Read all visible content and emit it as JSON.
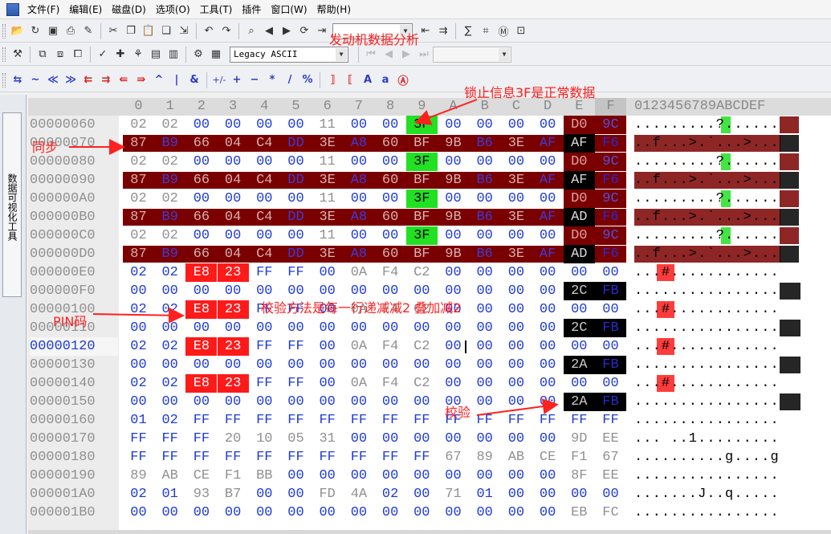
{
  "menu": [
    "文件(F)",
    "编辑(E)",
    "磁盘(D)",
    "选项(O)",
    "工具(T)",
    "插件",
    "窗口(W)",
    "帮助(H)"
  ],
  "toolbar": {
    "encoding": "Legacy ASCII"
  },
  "sidebar": {
    "tab": "数据可视化工具"
  },
  "hex": {
    "columns": [
      "0",
      "1",
      "2",
      "3",
      "4",
      "5",
      "6",
      "7",
      "8",
      "9",
      "A",
      "B",
      "C",
      "D",
      "E",
      "F"
    ],
    "ascii_header": "0123456789ABCDEF",
    "current_offset": "00000120",
    "rows": [
      {
        "offset": "00000060",
        "bytes": [
          "02",
          "02",
          "00",
          "00",
          "00",
          "00",
          "11",
          "00",
          "00",
          "3F",
          "00",
          "00",
          "00",
          "00",
          "D0",
          "9C"
        ],
        "ascii": ".........?......"
      },
      {
        "offset": "00000070",
        "bytes": [
          "87",
          "B9",
          "66",
          "04",
          "C4",
          "DD",
          "3E",
          "A8",
          "60",
          "BF",
          "9B",
          "B6",
          "3E",
          "AF",
          "AF",
          "F6"
        ],
        "ascii": "..f...>.`...>..."
      },
      {
        "offset": "00000080",
        "bytes": [
          "02",
          "02",
          "00",
          "00",
          "00",
          "00",
          "11",
          "00",
          "00",
          "3F",
          "00",
          "00",
          "00",
          "00",
          "D0",
          "9C"
        ],
        "ascii": ".........?......"
      },
      {
        "offset": "00000090",
        "bytes": [
          "87",
          "B9",
          "66",
          "04",
          "C4",
          "DD",
          "3E",
          "A8",
          "60",
          "BF",
          "9B",
          "B6",
          "3E",
          "AF",
          "AF",
          "F6"
        ],
        "ascii": "..f...>.`...>..."
      },
      {
        "offset": "000000A0",
        "bytes": [
          "02",
          "02",
          "00",
          "00",
          "00",
          "00",
          "11",
          "00",
          "00",
          "3F",
          "00",
          "00",
          "00",
          "00",
          "D0",
          "9C"
        ],
        "ascii": ".........?......"
      },
      {
        "offset": "000000B0",
        "bytes": [
          "87",
          "B9",
          "66",
          "04",
          "C4",
          "DD",
          "3E",
          "A8",
          "60",
          "BF",
          "9B",
          "B6",
          "3E",
          "AF",
          "AD",
          "F6"
        ],
        "ascii": "..f...>.`...>..."
      },
      {
        "offset": "000000C0",
        "bytes": [
          "02",
          "02",
          "00",
          "00",
          "00",
          "00",
          "11",
          "00",
          "00",
          "3F",
          "00",
          "00",
          "00",
          "00",
          "D0",
          "9C"
        ],
        "ascii": ".........?......"
      },
      {
        "offset": "000000D0",
        "bytes": [
          "87",
          "B9",
          "66",
          "04",
          "C4",
          "DD",
          "3E",
          "A8",
          "60",
          "BF",
          "9B",
          "B6",
          "3E",
          "AF",
          "AD",
          "F6"
        ],
        "ascii": "..f...>.`...>..."
      },
      {
        "offset": "000000E0",
        "bytes": [
          "02",
          "02",
          "E8",
          "23",
          "FF",
          "FF",
          "00",
          "0A",
          "F4",
          "C2",
          "00",
          "00",
          "00",
          "00",
          "00",
          "00"
        ],
        "ascii": "...#............"
      },
      {
        "offset": "000000F0",
        "bytes": [
          "00",
          "00",
          "00",
          "00",
          "00",
          "00",
          "00",
          "00",
          "00",
          "00",
          "00",
          "00",
          "00",
          "00",
          "2C",
          "FB"
        ],
        "ascii": "................"
      },
      {
        "offset": "00000100",
        "bytes": [
          "02",
          "02",
          "E8",
          "23",
          "FF",
          "FF",
          "00",
          "0A",
          "F4",
          "C2",
          "00",
          "00",
          "00",
          "00",
          "00",
          "00"
        ],
        "ascii": "...#............"
      },
      {
        "offset": "00000110",
        "bytes": [
          "00",
          "00",
          "00",
          "00",
          "00",
          "00",
          "00",
          "00",
          "00",
          "00",
          "00",
          "00",
          "00",
          "00",
          "2C",
          "FB"
        ],
        "ascii": "................"
      },
      {
        "offset": "00000120",
        "bytes": [
          "02",
          "02",
          "E8",
          "23",
          "FF",
          "FF",
          "00",
          "0A",
          "F4",
          "C2",
          "00",
          "00",
          "00",
          "00",
          "00",
          "00"
        ],
        "ascii": "...#............"
      },
      {
        "offset": "00000130",
        "bytes": [
          "00",
          "00",
          "00",
          "00",
          "00",
          "00",
          "00",
          "00",
          "00",
          "00",
          "00",
          "00",
          "00",
          "00",
          "2A",
          "FB"
        ],
        "ascii": "................"
      },
      {
        "offset": "00000140",
        "bytes": [
          "02",
          "02",
          "E8",
          "23",
          "FF",
          "FF",
          "00",
          "0A",
          "F4",
          "C2",
          "00",
          "00",
          "00",
          "00",
          "00",
          "00"
        ],
        "ascii": "...#............"
      },
      {
        "offset": "00000150",
        "bytes": [
          "00",
          "00",
          "00",
          "00",
          "00",
          "00",
          "00",
          "00",
          "00",
          "00",
          "00",
          "00",
          "00",
          "00",
          "2A",
          "FB"
        ],
        "ascii": "................"
      },
      {
        "offset": "00000160",
        "bytes": [
          "01",
          "02",
          "FF",
          "FF",
          "FF",
          "FF",
          "FF",
          "FF",
          "FF",
          "FF",
          "FF",
          "FF",
          "FF",
          "FF",
          "FF",
          "FF"
        ],
        "ascii": "................"
      },
      {
        "offset": "00000170",
        "bytes": [
          "FF",
          "FF",
          "FF",
          "20",
          "10",
          "05",
          "31",
          "00",
          "00",
          "00",
          "00",
          "00",
          "00",
          "00",
          "9D",
          "EE"
        ],
        "ascii": "... ..1........."
      },
      {
        "offset": "00000180",
        "bytes": [
          "FF",
          "FF",
          "FF",
          "FF",
          "FF",
          "FF",
          "FF",
          "FF",
          "FF",
          "FF",
          "67",
          "89",
          "AB",
          "CE",
          "F1",
          "67"
        ],
        "ascii": "..........g....g"
      },
      {
        "offset": "00000190",
        "bytes": [
          "89",
          "AB",
          "CE",
          "F1",
          "BB",
          "00",
          "00",
          "00",
          "00",
          "00",
          "00",
          "00",
          "00",
          "00",
          "8F",
          "EE"
        ],
        "ascii": "................"
      },
      {
        "offset": "000001A0",
        "bytes": [
          "02",
          "01",
          "93",
          "B7",
          "00",
          "00",
          "FD",
          "4A",
          "02",
          "00",
          "71",
          "01",
          "00",
          "00",
          "00",
          "00"
        ],
        "ascii": ".......J..q....."
      },
      {
        "offset": "000001B0",
        "bytes": [
          "00",
          "00",
          "00",
          "00",
          "00",
          "00",
          "00",
          "00",
          "00",
          "00",
          "00",
          "00",
          "00",
          "00",
          "EB",
          "FC"
        ],
        "ascii": "................"
      }
    ]
  },
  "annotations": {
    "engine": "发动机数据分析",
    "lock": "锁止信息3F是正常数据",
    "sync": "同步",
    "checksum_method": "校验方法是每一行递减减2  叠加减2",
    "pin": "PIN码",
    "checksum": "校验"
  },
  "colors": {
    "darkred": "#7a0000",
    "red": "#ff1a1a",
    "green": "#22e022",
    "black": "#000000",
    "annotation": "#ff2020",
    "blue": "#1f3bd6",
    "gray": "#909090"
  }
}
